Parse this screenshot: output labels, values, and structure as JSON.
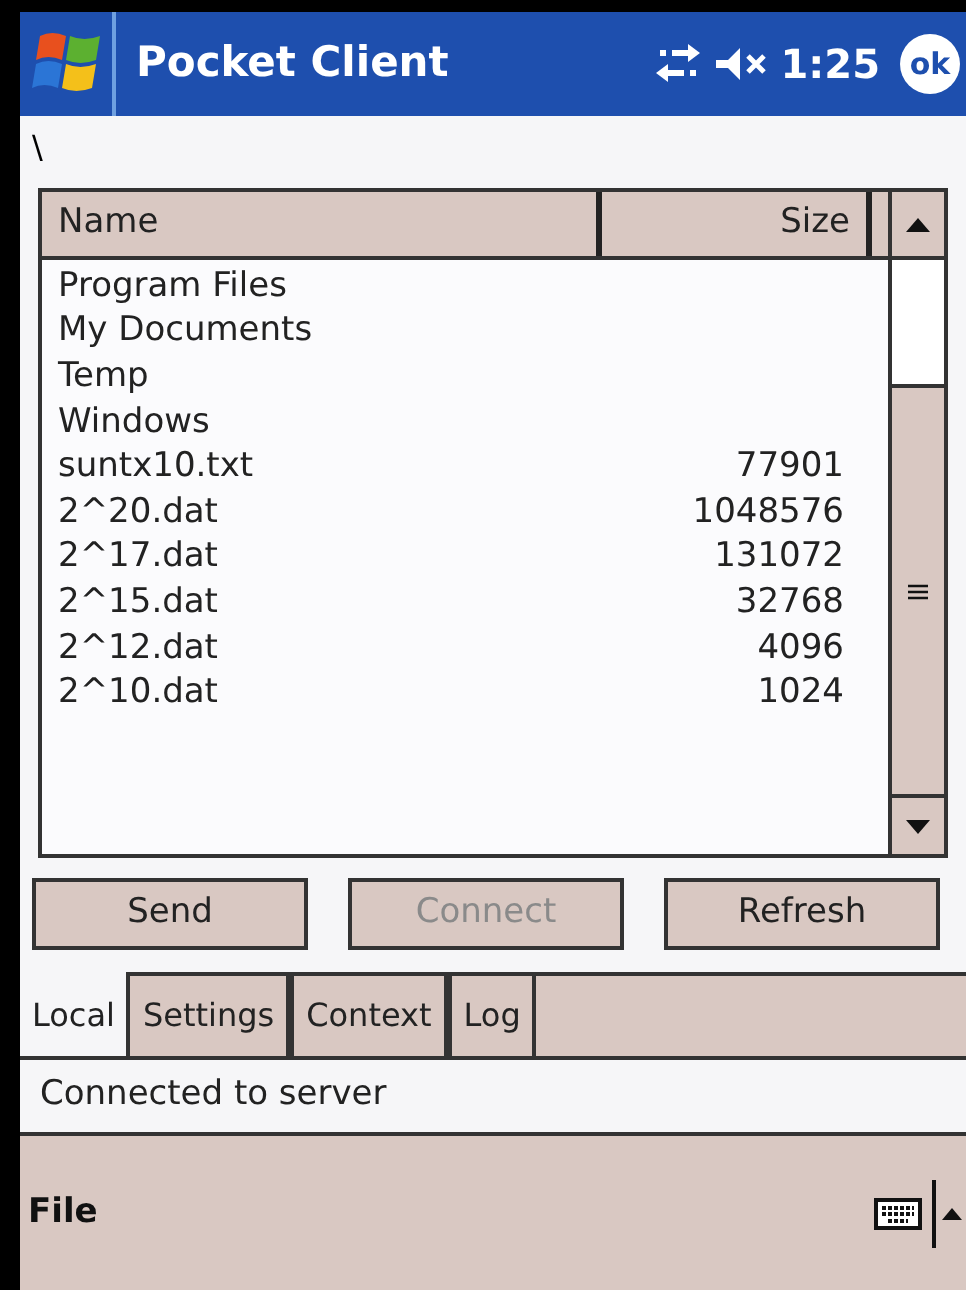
{
  "title_bar": {
    "title": "Pocket Client",
    "time": "1:25",
    "ok": "ok"
  },
  "path": "\\",
  "table": {
    "columns": [
      "Name",
      "Size"
    ],
    "rows": [
      {
        "name": "Program Files",
        "size": ""
      },
      {
        "name": "My Documents",
        "size": ""
      },
      {
        "name": "Temp",
        "size": ""
      },
      {
        "name": "Windows",
        "size": ""
      },
      {
        "name": "suntx10.txt",
        "size": "77901"
      },
      {
        "name": "2^20.dat",
        "size": "1048576"
      },
      {
        "name": "2^17.dat",
        "size": "131072"
      },
      {
        "name": "2^15.dat",
        "size": "32768"
      },
      {
        "name": "2^12.dat",
        "size": "4096"
      },
      {
        "name": "2^10.dat",
        "size": "1024"
      }
    ]
  },
  "buttons": [
    {
      "label": "Send",
      "disabled": false
    },
    {
      "label": "Connect",
      "disabled": true
    },
    {
      "label": "Refresh",
      "disabled": false
    }
  ],
  "tabs": [
    {
      "label": "Local",
      "selected": true
    },
    {
      "label": "Settings",
      "selected": false
    },
    {
      "label": "Context",
      "selected": false
    },
    {
      "label": "Log",
      "selected": false
    }
  ],
  "status": "Connected to server",
  "menu_bar": {
    "items": [
      "File"
    ]
  }
}
